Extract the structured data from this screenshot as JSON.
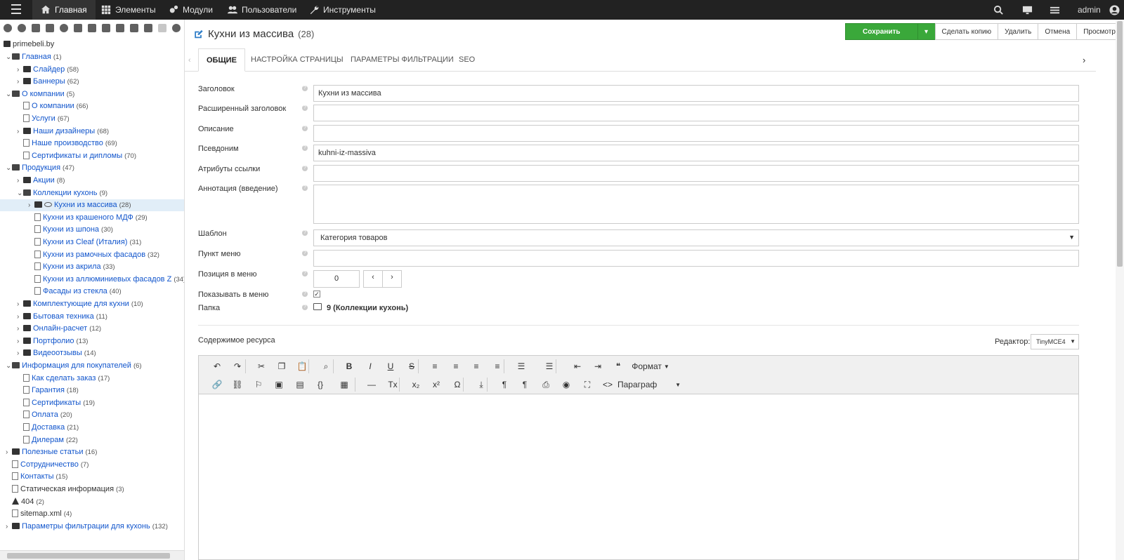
{
  "nav": {
    "items": [
      {
        "label": "Главная",
        "icon": "home-icon"
      },
      {
        "label": "Элементы",
        "icon": "grid-icon"
      },
      {
        "label": "Модули",
        "icon": "cogs-icon"
      },
      {
        "label": "Пользователи",
        "icon": "users-icon"
      },
      {
        "label": "Инструменты",
        "icon": "wrench-icon"
      }
    ],
    "user": "admin"
  },
  "tree": {
    "site": "primebeli.by",
    "items": [
      {
        "label": "Главная",
        "count": "(1)"
      },
      {
        "label": "Слайдер",
        "count": "(58)"
      },
      {
        "label": "Баннеры",
        "count": "(62)"
      },
      {
        "label": "О компании",
        "count": "(5)"
      },
      {
        "label": "О компании",
        "count": "(66)"
      },
      {
        "label": "Услуги",
        "count": "(67)"
      },
      {
        "label": "Наши дизайнеры",
        "count": "(68)"
      },
      {
        "label": "Наше производство",
        "count": "(69)"
      },
      {
        "label": "Сертификаты и дипломы",
        "count": "(70)"
      },
      {
        "label": "Продукция",
        "count": "(47)"
      },
      {
        "label": "Акции",
        "count": "(8)"
      },
      {
        "label": "Коллекции кухонь",
        "count": "(9)"
      },
      {
        "label": "Кухни из массива",
        "count": "(28)"
      },
      {
        "label": "Кухни из крашеного МДФ",
        "count": "(29)"
      },
      {
        "label": "Кухни из шпона",
        "count": "(30)"
      },
      {
        "label": "Кухни из Cleaf (Италия)",
        "count": "(31)"
      },
      {
        "label": "Кухни из рамочных фасадов",
        "count": "(32)"
      },
      {
        "label": "Кухни из акрила",
        "count": "(33)"
      },
      {
        "label": "Кухни из аллюминиевых фасадов Z",
        "count": "(34)"
      },
      {
        "label": "Фасады из стекла",
        "count": "(40)"
      },
      {
        "label": "Комплектующие для кухни",
        "count": "(10)"
      },
      {
        "label": "Бытовая техника",
        "count": "(11)"
      },
      {
        "label": "Онлайн-расчет",
        "count": "(12)"
      },
      {
        "label": "Портфолио",
        "count": "(13)"
      },
      {
        "label": "Видеоотзывы",
        "count": "(14)"
      },
      {
        "label": "Информация для покупателей",
        "count": "(6)"
      },
      {
        "label": "Как сделать заказ",
        "count": "(17)"
      },
      {
        "label": "Гарантия",
        "count": "(18)"
      },
      {
        "label": "Сертификаты",
        "count": "(19)"
      },
      {
        "label": "Оплата",
        "count": "(20)"
      },
      {
        "label": "Доставка",
        "count": "(21)"
      },
      {
        "label": "Дилерам",
        "count": "(22)"
      },
      {
        "label": "Полезные статьи",
        "count": "(16)"
      },
      {
        "label": "Сотрудничество",
        "count": "(7)"
      },
      {
        "label": "Контакты",
        "count": "(15)"
      },
      {
        "label": "Статическая информация",
        "count": "(3)"
      },
      {
        "label": "404",
        "count": "(2)"
      },
      {
        "label": "sitemap.xml",
        "count": "(4)"
      },
      {
        "label": "Параметры фильтрации для кухонь",
        "count": "(132)"
      }
    ]
  },
  "page": {
    "title": "Кухни из массива",
    "count": "(28)"
  },
  "actions": {
    "save": "Сохранить",
    "copy": "Сделать копию",
    "delete": "Удалить",
    "cancel": "Отмена",
    "preview": "Просмотр"
  },
  "tabs": [
    "Общие",
    "Настройка страницы",
    "Параметры фильтрации",
    "SEO"
  ],
  "form": {
    "title_label": "Заголовок",
    "title_value": "Кухни из массива",
    "longtitle_label": "Расширенный заголовок",
    "longtitle_value": "",
    "desc_label": "Описание",
    "desc_value": "",
    "alias_label": "Псевдоним",
    "alias_value": "kuhni-iz-massiva",
    "link_label": "Атрибуты ссылки",
    "link_value": "",
    "intro_label": "Аннотация (введение)",
    "intro_value": "",
    "template_label": "Шаблон",
    "template_value": "Категория товаров",
    "menutitle_label": "Пункт меню",
    "menutitle_value": "",
    "menuindex_label": "Позиция в меню",
    "menuindex_value": "0",
    "hidemenu_label": "Показывать в меню",
    "hidemenu_checked": true,
    "parent_label": "Папка",
    "parent_value": "9 (Коллекции кухонь)",
    "content_label": "Содержимое ресурса",
    "editor_label": "Редактор:",
    "editor_value": "TinyMCE4"
  },
  "editor": {
    "format": "Формат",
    "block": "Параграф"
  }
}
